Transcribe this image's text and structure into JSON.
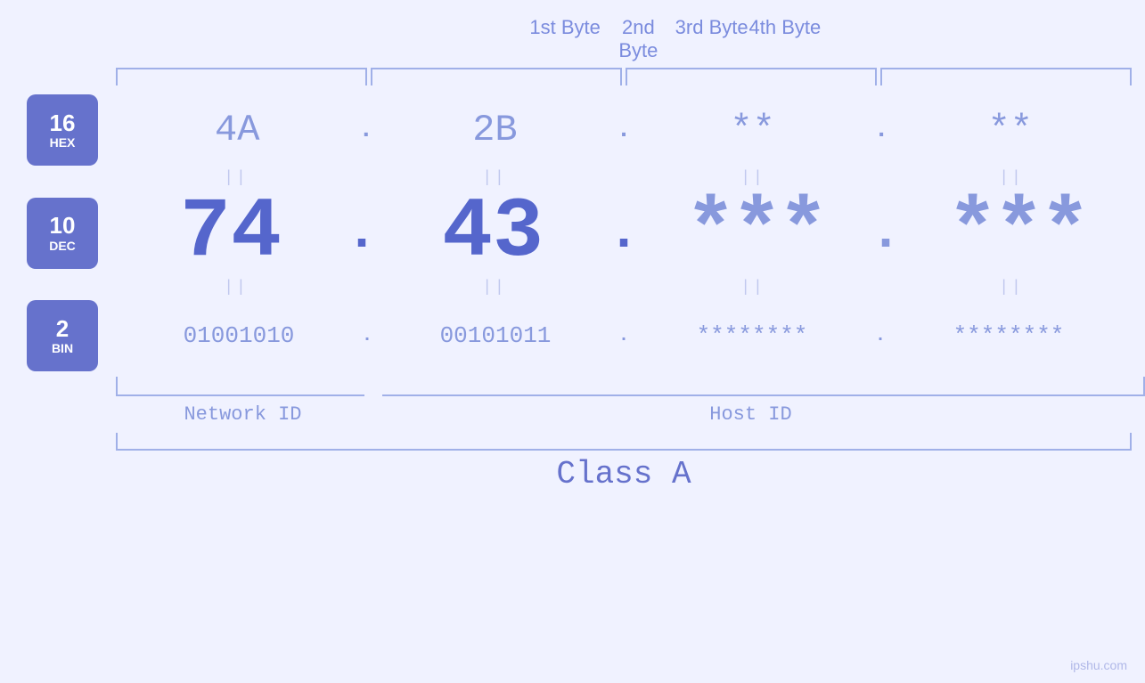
{
  "header": {
    "bytes": [
      "1st Byte",
      "2nd Byte",
      "3rd Byte",
      "4th Byte"
    ]
  },
  "badges": [
    {
      "number": "16",
      "label": "HEX"
    },
    {
      "number": "10",
      "label": "DEC"
    },
    {
      "number": "2",
      "label": "BIN"
    }
  ],
  "rows": {
    "hex": {
      "values": [
        "4A",
        "2B",
        "**",
        "**"
      ],
      "dots": [
        ".",
        ".",
        ".",
        ""
      ]
    },
    "dec": {
      "values": [
        "74",
        "43",
        "***",
        "***"
      ],
      "dots": [
        ".",
        ".",
        ".",
        ""
      ]
    },
    "bin": {
      "values": [
        "01001010",
        "00101011",
        "********",
        "********"
      ],
      "dots": [
        ".",
        ".",
        ".",
        ""
      ]
    }
  },
  "labels": {
    "network_id": "Network ID",
    "host_id": "Host ID",
    "class": "Class A"
  },
  "watermark": "ipshu.com",
  "separators": [
    "||",
    "||",
    "||",
    "||"
  ]
}
